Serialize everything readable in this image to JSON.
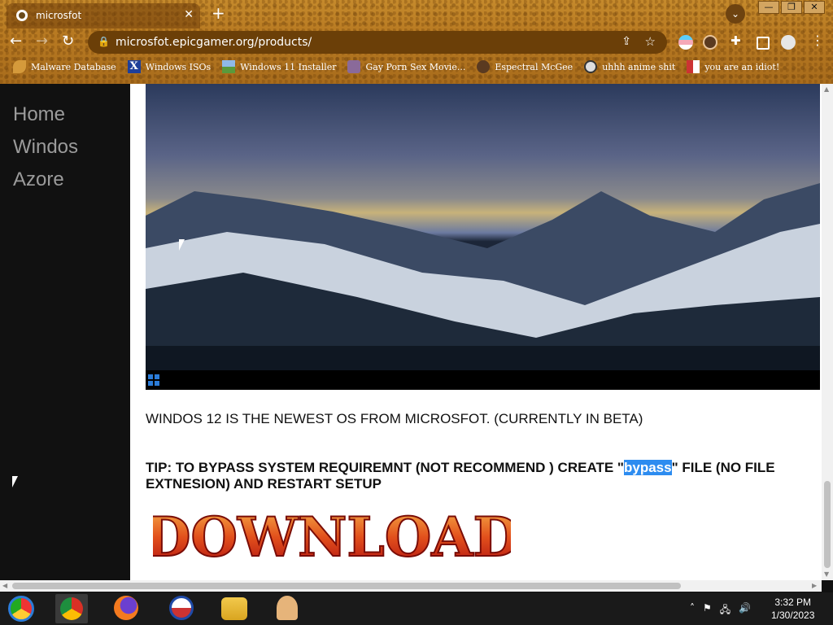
{
  "browser": {
    "tab_title": "microsfot",
    "tab_close": "✕",
    "new_tab": "+",
    "url": "microsfot.epicgamer.org/products/",
    "window_buttons": [
      "—",
      "❐",
      "✕"
    ],
    "bookmarks": [
      {
        "label": "Malware Database",
        "icon": "leaf-icon"
      },
      {
        "label": "Windows ISOs",
        "icon": "x-icon"
      },
      {
        "label": "Windows 11 Installer",
        "icon": "image-icon"
      },
      {
        "label": "Gay Porn Sex Movie...",
        "icon": "avatar-icon"
      },
      {
        "label": "Espectral McGee",
        "icon": "avatar-icon"
      },
      {
        "label": "uhhh anime shit",
        "icon": "avatar-icon"
      },
      {
        "label": "you are an idiot!",
        "icon": "flag-icon"
      }
    ]
  },
  "page": {
    "nav": [
      "Home",
      "Windos",
      "Azore"
    ],
    "description": "WINDOS 12 IS THE NEWEST OS FROM MICROSFOT. (CURRENTLY IN BETA)",
    "tip_before": "TIP: TO BYPASS SYSTEM REQUIREMNT (NOT RECOMMEND ) CREATE \"",
    "tip_highlight": "bypass",
    "tip_after": "\" FILE (NO FILE EXTNESION) AND RESTART SETUP",
    "download_label": "DOWNLOAD"
  },
  "taskbar": {
    "time": "3:32 PM",
    "date": "1/30/2023"
  },
  "colors": {
    "chrome_bg": "#b87a22",
    "highlight": "#2d8cf0",
    "download_fill": "#c8281a"
  }
}
